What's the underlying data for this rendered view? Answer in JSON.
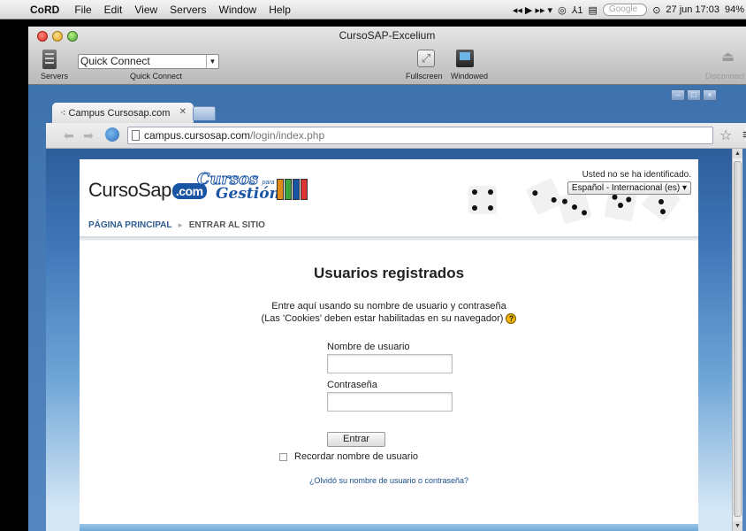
{
  "menubar": {
    "app_name": "CoRD",
    "items": [
      "File",
      "Edit",
      "View",
      "Servers",
      "Window",
      "Help"
    ],
    "media_controls": "◂◂ ▶ ▸▸ ▾",
    "search_placeholder": "Google",
    "date_time": "27 jun 17:03",
    "battery": "94%"
  },
  "cord": {
    "title": "CursoSAP-Excelium",
    "servers_label": "Servers",
    "quick_connect_value": "Quick Connect",
    "quick_connect_label": "Quick Connect",
    "fullscreen_label": "Fullscreen",
    "windowed_label": "Windowed",
    "disconnect_label": "Disconnect"
  },
  "browser": {
    "tab_title": "Campus Cursosap.com",
    "url_domain": "campus.cursosap.com",
    "url_path": "/login/index.php"
  },
  "page": {
    "logo_prefix": "CursoSap",
    "logo_suffix": ".com",
    "logo2_cursos": "Cursos",
    "logo2_para": "para",
    "logo2_gestion": "Gestión",
    "login_status": "Usted no se ha identificado.",
    "language": "Español - Internacional (es) ▾",
    "breadcrumb": {
      "home": "PÁGINA PRINCIPAL",
      "separator": "►",
      "current": "ENTRAR AL SITIO"
    },
    "login": {
      "title": "Usuarios registrados",
      "intro_line1": "Entre aquí usando su nombre de usuario y contraseña",
      "intro_line2": "(Las 'Cookies' deben estar habilitadas en su navegador)",
      "username_label": "Nombre de usuario",
      "username_value": "",
      "password_label": "Contraseña",
      "password_value": "",
      "submit_label": "Entrar",
      "remember_label": "Recordar nombre de usuario",
      "forgot_link": "¿Olvidó su nombre de usuario o contraseña?"
    }
  }
}
